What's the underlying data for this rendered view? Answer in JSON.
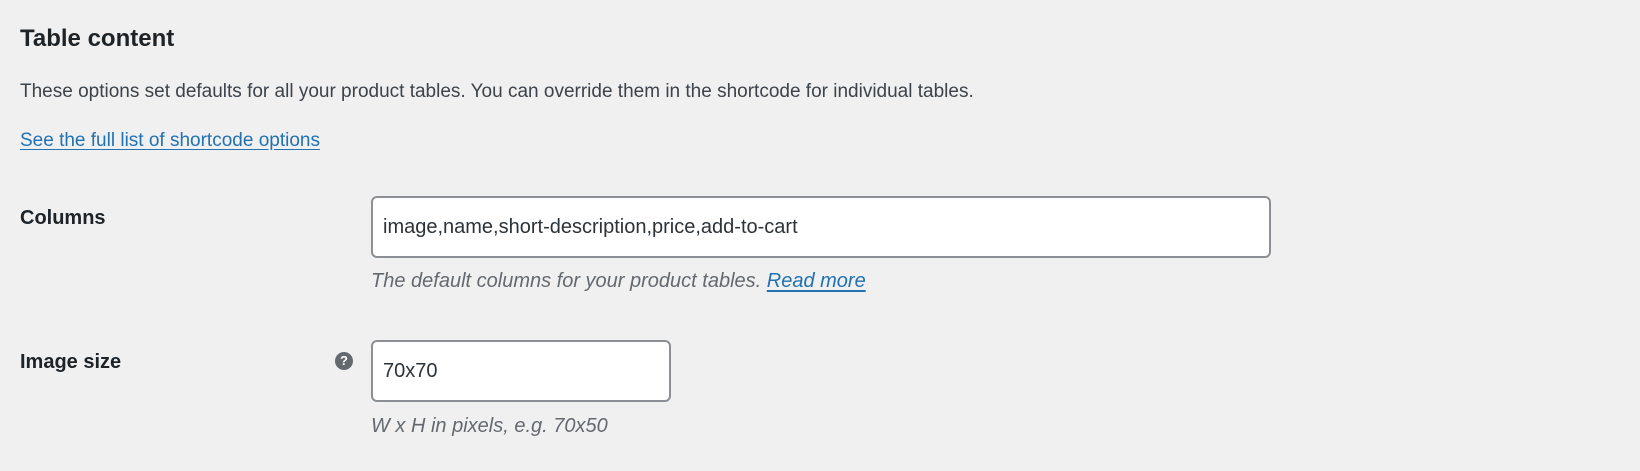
{
  "section": {
    "title": "Table content",
    "description": "These options set defaults for all your product tables. You can override them in the shortcode for individual tables.",
    "full_list_link": "See the full list of shortcode options"
  },
  "fields": {
    "columns": {
      "label": "Columns",
      "value": "image,name,short-description,price,add-to-cart",
      "description": "The default columns for your product tables.",
      "read_more": "Read more"
    },
    "image_size": {
      "label": "Image size",
      "help_icon": "help-icon",
      "value": "70x70",
      "description": "W x H in pixels, e.g. 70x50"
    }
  },
  "colors": {
    "background": "#f0f0f1",
    "link": "#2271b1",
    "text": "#1d2327",
    "muted": "#646970",
    "input_border": "#8c8f94"
  }
}
